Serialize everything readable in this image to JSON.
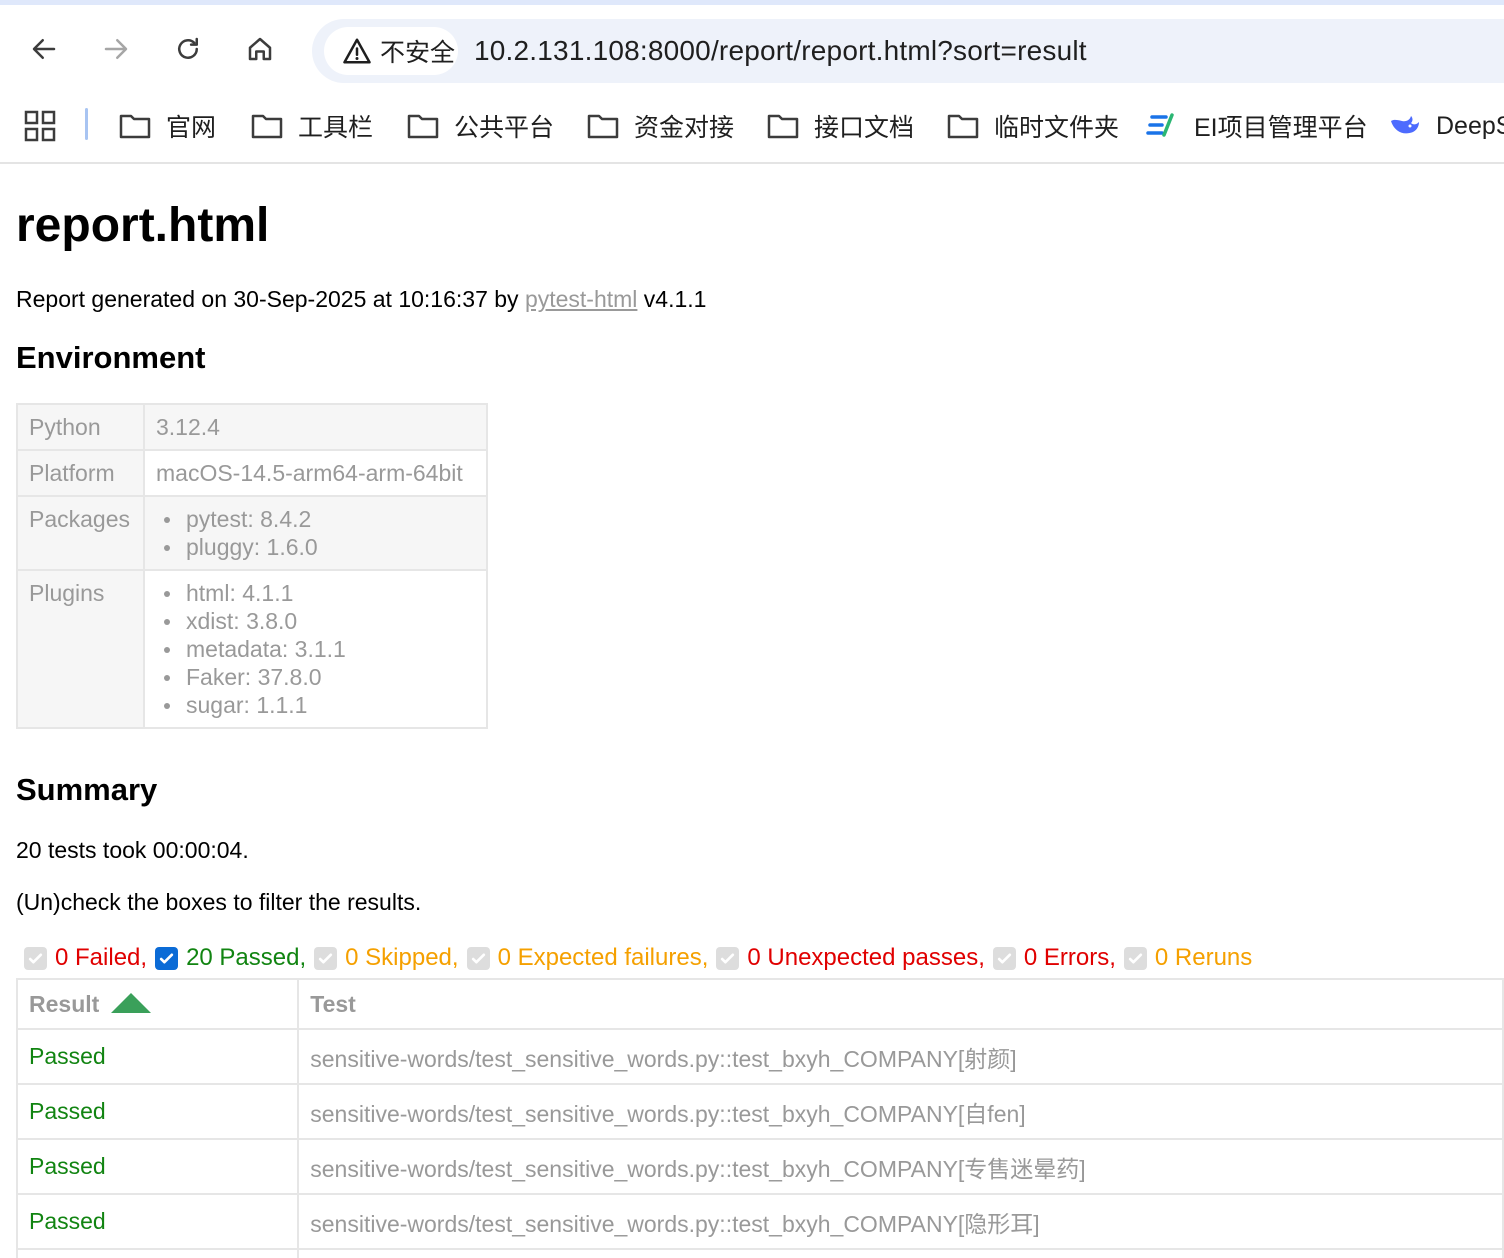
{
  "browser": {
    "security_label": "不安全",
    "url": "10.2.131.108:8000/report/report.html?sort=result",
    "bookmarks": [
      "官网",
      "工具栏",
      "公共平台",
      "资金对接",
      "接口文档",
      "临时文件夹",
      "EI项目管理平台",
      "DeepS"
    ]
  },
  "report": {
    "title": "report.html",
    "generated_prefix": "Report generated on 30-Sep-2025 at 10:16:37 by ",
    "generated_link": "pytest-html",
    "generated_suffix": " v4.1.1",
    "environment_heading": "Environment",
    "environment": {
      "python_key": "Python",
      "python_value": "3.12.4",
      "platform_key": "Platform",
      "platform_value": "macOS-14.5-arm64-arm-64bit",
      "packages_key": "Packages",
      "packages": [
        "pytest: 8.4.2",
        "pluggy: 1.6.0"
      ],
      "plugins_key": "Plugins",
      "plugins": [
        "html: 4.1.1",
        "xdist: 3.8.0",
        "metadata: 3.1.1",
        "Faker: 37.8.0",
        "sugar: 1.1.1"
      ]
    },
    "summary_heading": "Summary",
    "summary_line": "20 tests took 00:00:04.",
    "filter_hint": "(Un)check the boxes to filter the results.",
    "filters": [
      {
        "label": "0 Failed,",
        "checked": false,
        "color": "#e00000"
      },
      {
        "label": "20 Passed,",
        "checked": true,
        "color": "#118411"
      },
      {
        "label": "0 Skipped,",
        "checked": false,
        "color": "#f5a000"
      },
      {
        "label": "0 Expected failures,",
        "checked": false,
        "color": "#f5a000"
      },
      {
        "label": "0 Unexpected passes,",
        "checked": false,
        "color": "#e00000"
      },
      {
        "label": "0 Errors,",
        "checked": false,
        "color": "#e00000"
      },
      {
        "label": "0 Reruns",
        "checked": false,
        "color": "#f5a000"
      }
    ],
    "table": {
      "col_result": "Result",
      "col_test": "Test",
      "rows": [
        {
          "result": "Passed",
          "test": "sensitive-words/test_sensitive_words.py::test_bxyh_COMPANY[射颜]"
        },
        {
          "result": "Passed",
          "test": "sensitive-words/test_sensitive_words.py::test_bxyh_COMPANY[自fen]"
        },
        {
          "result": "Passed",
          "test": "sensitive-words/test_sensitive_words.py::test_bxyh_COMPANY[专售迷晕药]"
        },
        {
          "result": "Passed",
          "test": "sensitive-words/test_sensitive_words.py::test_bxyh_COMPANY[隐形耳]"
        }
      ]
    }
  }
}
